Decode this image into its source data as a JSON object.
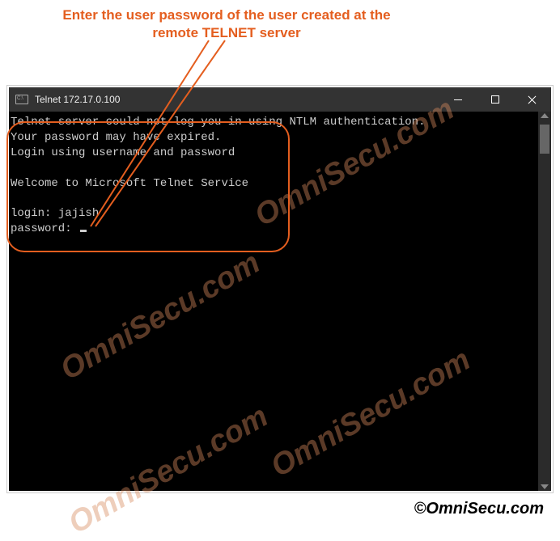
{
  "annotation": {
    "text": "Enter the user password of the user created at the remote TELNET server"
  },
  "window": {
    "title": "Telnet 172.17.0.100"
  },
  "terminal": {
    "line1": "Telnet server could not log you in using NTLM authentication.",
    "line2": "Your password may have expired.",
    "line3": "Login using username and password",
    "line4": "Welcome to Microsoft Telnet Service",
    "login_label": "login: ",
    "login_value": "jajish",
    "password_label": "password: "
  },
  "watermark": "OmniSecu.com",
  "copyright": "©OmniSecu.com",
  "colors": {
    "annotation": "#e45e1f",
    "titlebar": "#333333",
    "terminal_bg": "#000000",
    "terminal_fg": "#cccccc"
  }
}
